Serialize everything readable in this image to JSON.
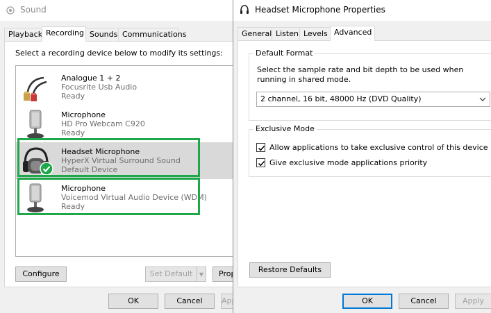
{
  "sound_window": {
    "title": "Sound",
    "tabs": [
      {
        "label": "Playback"
      },
      {
        "label": "Recording"
      },
      {
        "label": "Sounds"
      },
      {
        "label": "Communications"
      }
    ],
    "instruction": "Select a recording device below to modify its settings:",
    "devices": [
      {
        "name": "Analogue 1 + 2",
        "description": "Focusrite Usb Audio",
        "status": "Ready",
        "icon": "rca-cable-icon"
      },
      {
        "name": "Microphone",
        "description": "HD Pro Webcam C920",
        "status": "Ready",
        "icon": "microphone-icon"
      },
      {
        "name": "Headset Microphone",
        "description": "HyperX Virtual Surround Sound",
        "status": "Default Device",
        "icon": "headset-icon"
      },
      {
        "name": "Microphone",
        "description": "Voicemod Virtual Audio Device (WDM)",
        "status": "Ready",
        "icon": "microphone-icon"
      }
    ],
    "buttons": {
      "configure": "Configure",
      "set_default": "Set Default",
      "properties": "Properties",
      "ok": "OK",
      "cancel": "Cancel",
      "apply": "Apply"
    }
  },
  "properties_window": {
    "title": "Headset Microphone Properties",
    "tabs": [
      {
        "label": "General"
      },
      {
        "label": "Listen"
      },
      {
        "label": "Levels"
      },
      {
        "label": "Advanced"
      }
    ],
    "default_format": {
      "label": "Default Format",
      "description": "Select the sample rate and bit depth to be used when running in shared mode.",
      "selected": "2 channel, 16 bit, 48000 Hz (DVD Quality)"
    },
    "exclusive_mode": {
      "label": "Exclusive Mode",
      "options": [
        {
          "label": "Allow applications to take exclusive control of this device",
          "checked": true
        },
        {
          "label": "Give exclusive mode applications priority",
          "checked": true
        }
      ]
    },
    "buttons": {
      "restore_defaults": "Restore Defaults",
      "ok": "OK",
      "cancel": "Cancel",
      "apply": "Apply"
    }
  },
  "colors": {
    "highlight": "#1fa84a",
    "selected_row": "#d9d9d9",
    "accent": "#0078d7"
  }
}
